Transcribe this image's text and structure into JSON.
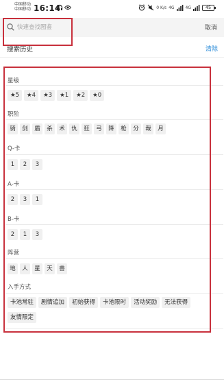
{
  "status": {
    "carrier1": "中国移动",
    "carrier2": "中国移动",
    "time": "16:14",
    "speed": "0 K/s",
    "net1": "4G",
    "net2": "4G",
    "battery": "45"
  },
  "search": {
    "placeholder": "快速查找图鉴",
    "value": "",
    "cancel_label": "取消"
  },
  "history": {
    "title": "搜索历史",
    "clear_label": "清除"
  },
  "filters": {
    "star": {
      "label": "星级",
      "options": [
        "★5",
        "★4",
        "★3",
        "★1",
        "★2",
        "★0"
      ]
    },
    "job": {
      "label": "职阶",
      "options": [
        "骑",
        "剑",
        "盾",
        "杀",
        "术",
        "仇",
        "狂",
        "弓",
        "降",
        "枪",
        "分",
        "裁",
        "月"
      ]
    },
    "q_card": {
      "label": "Q-卡",
      "options": [
        "1",
        "2",
        "3"
      ]
    },
    "a_card": {
      "label": "A-卡",
      "options": [
        "2",
        "3",
        "1"
      ]
    },
    "b_card": {
      "label": "B-卡",
      "options": [
        "2",
        "1",
        "3"
      ]
    },
    "camp": {
      "label": "阵营",
      "options": [
        "地",
        "人",
        "星",
        "天",
        "兽"
      ]
    },
    "obtain": {
      "label": "入手方式",
      "options": [
        "卡池常驻",
        "剧情追加",
        "初始获得",
        "卡池限时",
        "活动奖励",
        "无法获得",
        "友情限定"
      ]
    }
  },
  "colors": {
    "highlight": "#c8303c",
    "link": "#2a8bd8",
    "tag_bg": "#f0f0f0"
  }
}
